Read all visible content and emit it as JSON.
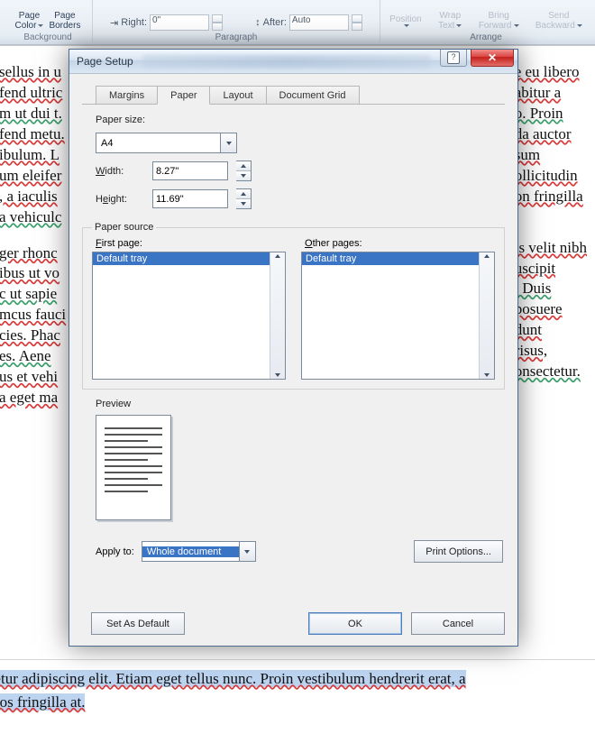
{
  "ribbon": {
    "page_color": {
      "l1": "Page",
      "l2": "Color"
    },
    "page_borders": {
      "l1": "Page",
      "l2": "Borders"
    },
    "background_group": "Background",
    "right_lbl": "Right:",
    "right_val": "0\"",
    "after_lbl": "After:",
    "after_val": "Auto",
    "paragraph_group": "Paragraph",
    "position": {
      "l1": "Position"
    },
    "wrap": {
      "l1": "Wrap",
      "l2": "Text"
    },
    "bring": {
      "l1": "Bring",
      "l2": "Forward"
    },
    "send": {
      "l1": "Send",
      "l2": "Backward"
    },
    "arrange_group": "Arrange"
  },
  "doc": {
    "lines": [
      "sellus in u",
      "fend ultric",
      "m ut dui t.",
      "fend metu.",
      "ibulum. L",
      "um eleifer",
      ", a iaculis",
      "a vehiculc",
      "",
      "ger rhonc",
      "ibus ut vo",
      "c ut sapie",
      "mcus fauci",
      "cies. Phac",
      "es. Aene",
      "us et vehi",
      "a eget ma"
    ],
    "right": [
      "e eu libero",
      "abitur a",
      "o. Proin",
      "da auctor",
      "sum",
      "ollicitudin",
      "on fringilla",
      "",
      "",
      "is velit nibh",
      "uscipit",
      ". Duis",
      "posuere",
      "dunt",
      "risus,",
      "onsectetur."
    ],
    "bottom1": "sectetur adipiscing elit. Etiam eget tellus nunc. Proin vestibulum hendrerit erat, a",
    "bottom2": "us eros fringilla at."
  },
  "dialog": {
    "title": "Page Setup",
    "tabs": {
      "margins": "Margins",
      "paper": "Paper",
      "layout": "Layout",
      "grid": "Document Grid"
    },
    "paper_size_lbl": "Paper size:",
    "paper_size_value": "A4",
    "width_lbl": "Width:",
    "width_lbl_u": "W",
    "width_val": "8.27\"",
    "height_lbl": "Height:",
    "height_lbl_u": "H",
    "height_val": "11.69\"",
    "paper_source_lbl": "Paper source",
    "first_page_lbl": "First page:",
    "first_page_u": "F",
    "other_pages_lbl": "Other pages:",
    "other_pages_u": "O",
    "first_items": [
      "Default tray"
    ],
    "other_items": [
      "Default tray"
    ],
    "preview_lbl": "Preview",
    "apply_lbl": "Apply to:",
    "apply_val": "Whole document",
    "print_options": "Print Options...",
    "set_default": "Set As Default",
    "ok": "OK",
    "cancel": "Cancel"
  }
}
